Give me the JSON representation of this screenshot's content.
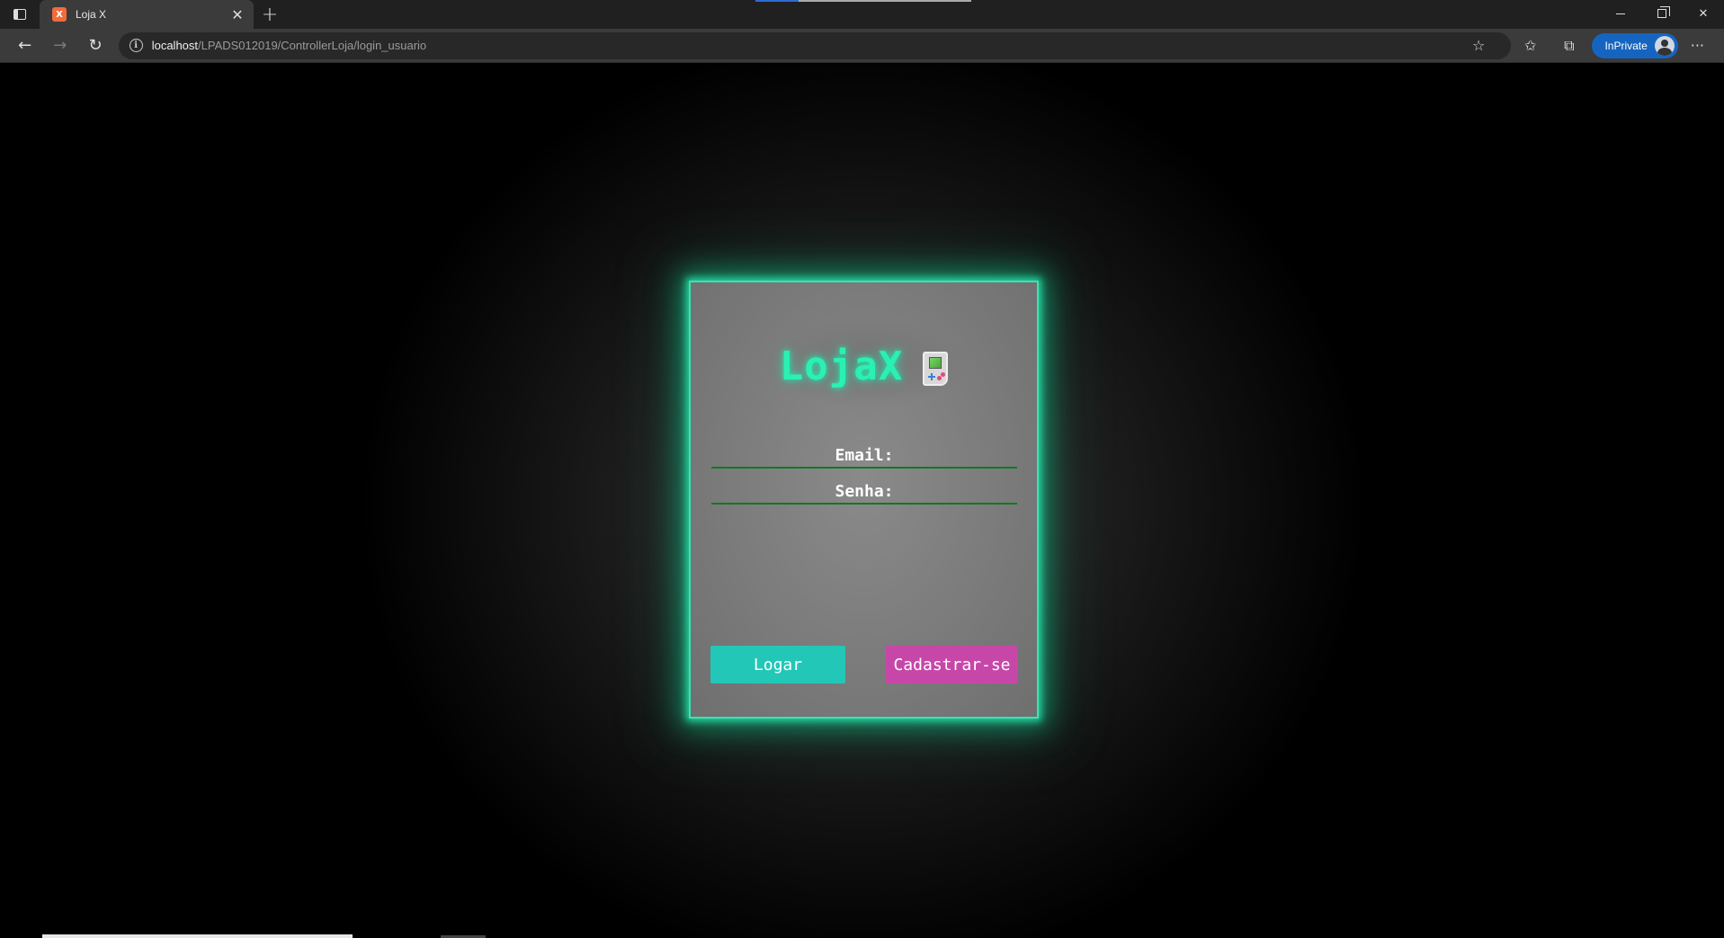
{
  "browser": {
    "tab": {
      "title": "Loja X",
      "favicon": "X"
    },
    "address": {
      "host": "localhost",
      "path": "/LPADS012019/ControllerLoja/login_usuario"
    },
    "inprivate_label": "InPrivate",
    "accent": "#1565c0"
  },
  "page": {
    "logo_text": "LojaX",
    "logo_icon": "gameboy-icon",
    "fields": {
      "email_label": "Email:",
      "password_label": "Senha:"
    },
    "buttons": {
      "login": "Logar",
      "signup": "Cadastrar-se"
    },
    "colors": {
      "glow": "#25d6a0",
      "logo": "#2af0b4",
      "login_button": "#22c7b7",
      "signup_button": "#c747a9",
      "field_underline": "#0f7a1e"
    }
  }
}
